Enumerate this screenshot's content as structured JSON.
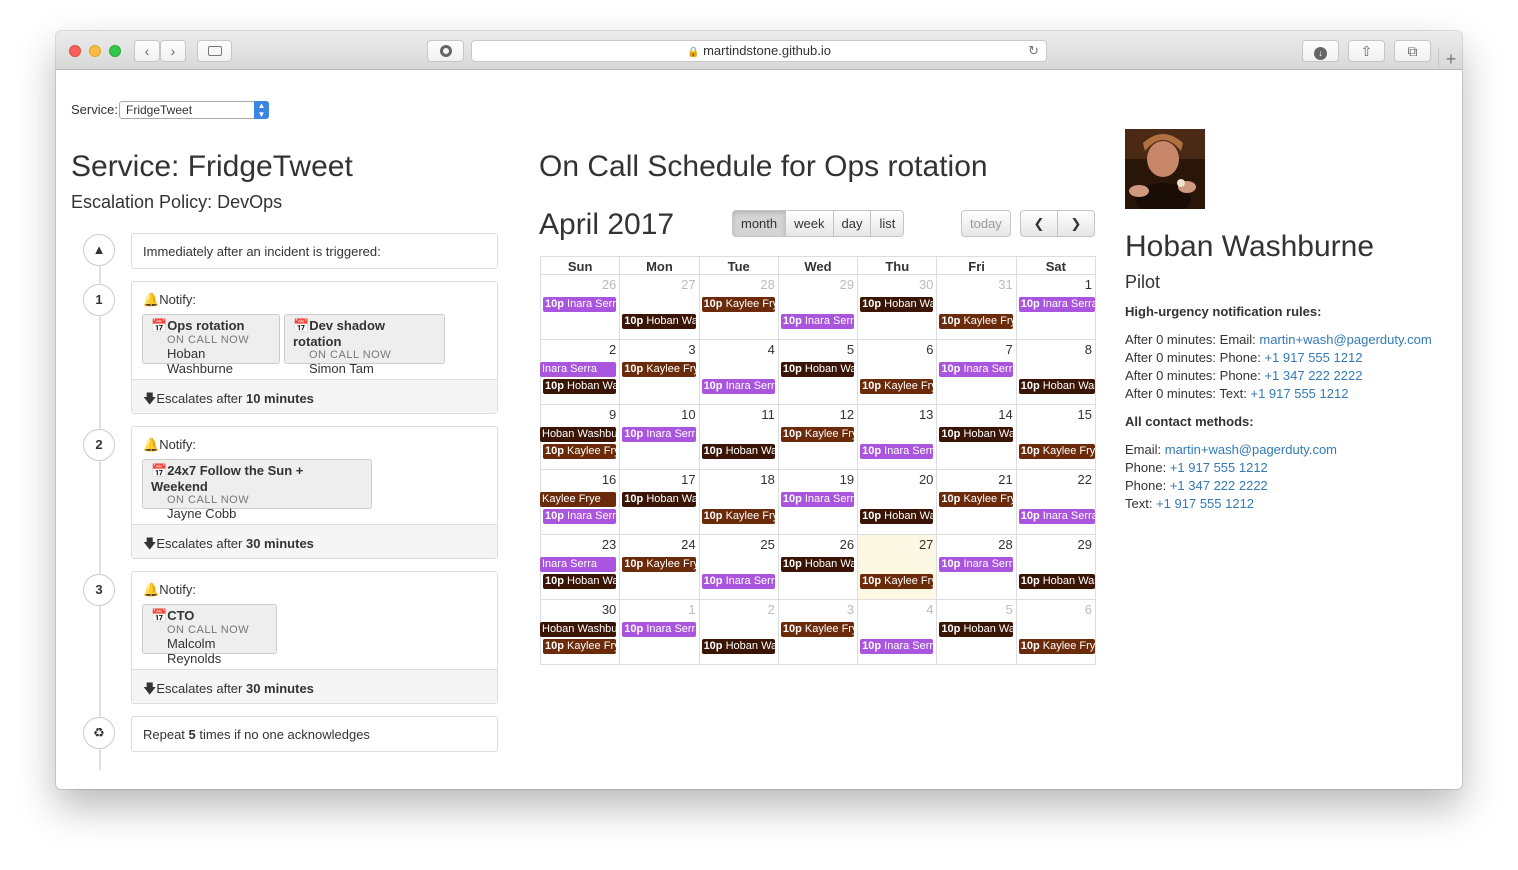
{
  "browser": {
    "url": "martindstone.github.io"
  },
  "service_select": {
    "label": "Service:",
    "value": "FridgeTweet"
  },
  "service": {
    "title": "Service: FridgeTweet",
    "escalation_policy": "Escalation Policy: DevOps",
    "trigger_text": "Immediately after an incident is triggered:",
    "rules": [
      {
        "number": "1",
        "notify_label": "Notify:",
        "targets": [
          {
            "name": "Ops rotation",
            "status": "ON CALL NOW",
            "person": "Hoban Washburne"
          },
          {
            "name": "Dev shadow rotation",
            "status": "ON CALL NOW",
            "person": "Simon Tam"
          }
        ],
        "escalate_prefix": "Escalates after ",
        "escalate_value": "10 minutes"
      },
      {
        "number": "2",
        "notify_label": "Notify:",
        "targets": [
          {
            "name": "24x7 Follow the Sun + Weekend",
            "status": "ON CALL NOW",
            "person": "Jayne Cobb"
          }
        ],
        "escalate_prefix": "Escalates after ",
        "escalate_value": "30 minutes"
      },
      {
        "number": "3",
        "notify_label": "Notify:",
        "targets": [
          {
            "name": "CTO",
            "status": "ON CALL NOW",
            "person": "Malcolm Reynolds"
          }
        ],
        "escalate_prefix": "Escalates after ",
        "escalate_value": "30 minutes"
      }
    ],
    "repeat_prefix": "Repeat ",
    "repeat_count": "5",
    "repeat_suffix": " times if no one acknowledges"
  },
  "calendar": {
    "title": "On Call Schedule for Ops rotation",
    "month": "April 2017",
    "view_buttons": [
      "month",
      "week",
      "day",
      "list"
    ],
    "active_view": "month",
    "today_label": "today",
    "prev_icon": "chevron-left-icon",
    "next_icon": "chevron-right-icon",
    "dow": [
      "Sun",
      "Mon",
      "Tue",
      "Wed",
      "Thu",
      "Fri",
      "Sat"
    ],
    "weeks": [
      [
        "26",
        "27",
        "28",
        "29",
        "30",
        "31",
        "1"
      ],
      [
        "2",
        "3",
        "4",
        "5",
        "6",
        "7",
        "8"
      ],
      [
        "9",
        "10",
        "11",
        "12",
        "13",
        "14",
        "15"
      ],
      [
        "16",
        "17",
        "18",
        "19",
        "20",
        "21",
        "22"
      ],
      [
        "23",
        "24",
        "25",
        "26",
        "27",
        "28",
        "29"
      ],
      [
        "30",
        "1",
        "2",
        "3",
        "4",
        "5",
        "6"
      ]
    ],
    "today": "27",
    "people_colors": {
      "Inara Serra": "#aa55dd",
      "Kaylee Frye": "#6b2a0a",
      "Hoban Washburne": "#3a1505"
    },
    "events": [
      {
        "week": 0,
        "row": 0,
        "start": 0,
        "end": 1,
        "time": "10p",
        "name": "Inara Serra"
      },
      {
        "week": 0,
        "row": 0,
        "start": 2,
        "end": 3,
        "time": "10p",
        "name": "Kaylee Frye"
      },
      {
        "week": 0,
        "row": 0,
        "start": 4,
        "end": 5,
        "time": "10p",
        "name": "Hoban Washburne"
      },
      {
        "week": 0,
        "row": 0,
        "start": 6,
        "end": 7,
        "time": "10p",
        "name": "Inara Serra"
      },
      {
        "week": 0,
        "row": 1,
        "start": 1,
        "end": 2,
        "time": "10p",
        "name": "Hoban Washburne"
      },
      {
        "week": 0,
        "row": 1,
        "start": 3,
        "end": 4,
        "time": "10p",
        "name": "Inara Serra"
      },
      {
        "week": 0,
        "row": 1,
        "start": 5,
        "end": 6,
        "time": "10p",
        "name": "Kaylee Frye"
      },
      {
        "week": 1,
        "row": 0,
        "start": 0,
        "end": 1,
        "time": "",
        "name": "Inara Serra"
      },
      {
        "week": 1,
        "row": 0,
        "start": 1,
        "end": 2,
        "time": "10p",
        "name": "Kaylee Frye"
      },
      {
        "week": 1,
        "row": 0,
        "start": 3,
        "end": 4,
        "time": "10p",
        "name": "Hoban Washburne"
      },
      {
        "week": 1,
        "row": 0,
        "start": 5,
        "end": 6,
        "time": "10p",
        "name": "Inara Serra"
      },
      {
        "week": 1,
        "row": 1,
        "start": 0,
        "end": 1,
        "time": "10p",
        "name": "Hoban Washburne"
      },
      {
        "week": 1,
        "row": 1,
        "start": 2,
        "end": 3,
        "time": "10p",
        "name": "Inara Serra"
      },
      {
        "week": 1,
        "row": 1,
        "start": 4,
        "end": 5,
        "time": "10p",
        "name": "Kaylee Frye"
      },
      {
        "week": 1,
        "row": 1,
        "start": 6,
        "end": 7,
        "time": "10p",
        "name": "Hoban Washburne"
      },
      {
        "week": 2,
        "row": 0,
        "start": 0,
        "end": 1,
        "time": "",
        "name": "Hoban Washburne"
      },
      {
        "week": 2,
        "row": 0,
        "start": 1,
        "end": 2,
        "time": "10p",
        "name": "Inara Serra"
      },
      {
        "week": 2,
        "row": 0,
        "start": 3,
        "end": 4,
        "time": "10p",
        "name": "Kaylee Frye"
      },
      {
        "week": 2,
        "row": 0,
        "start": 5,
        "end": 6,
        "time": "10p",
        "name": "Hoban Washburne"
      },
      {
        "week": 2,
        "row": 1,
        "start": 0,
        "end": 1,
        "time": "10p",
        "name": "Kaylee Frye"
      },
      {
        "week": 2,
        "row": 1,
        "start": 2,
        "end": 3,
        "time": "10p",
        "name": "Hoban Washburne"
      },
      {
        "week": 2,
        "row": 1,
        "start": 4,
        "end": 5,
        "time": "10p",
        "name": "Inara Serra"
      },
      {
        "week": 2,
        "row": 1,
        "start": 6,
        "end": 7,
        "time": "10p",
        "name": "Kaylee Frye"
      },
      {
        "week": 3,
        "row": 0,
        "start": 0,
        "end": 1,
        "time": "",
        "name": "Kaylee Frye"
      },
      {
        "week": 3,
        "row": 0,
        "start": 1,
        "end": 2,
        "time": "10p",
        "name": "Hoban Washburne"
      },
      {
        "week": 3,
        "row": 0,
        "start": 3,
        "end": 4,
        "time": "10p",
        "name": "Inara Serra"
      },
      {
        "week": 3,
        "row": 0,
        "start": 5,
        "end": 6,
        "time": "10p",
        "name": "Kaylee Frye"
      },
      {
        "week": 3,
        "row": 1,
        "start": 0,
        "end": 1,
        "time": "10p",
        "name": "Inara Serra"
      },
      {
        "week": 3,
        "row": 1,
        "start": 2,
        "end": 3,
        "time": "10p",
        "name": "Kaylee Frye"
      },
      {
        "week": 3,
        "row": 1,
        "start": 4,
        "end": 5,
        "time": "10p",
        "name": "Hoban Washburne"
      },
      {
        "week": 3,
        "row": 1,
        "start": 6,
        "end": 7,
        "time": "10p",
        "name": "Inara Serra"
      },
      {
        "week": 4,
        "row": 0,
        "start": 0,
        "end": 1,
        "time": "",
        "name": "Inara Serra"
      },
      {
        "week": 4,
        "row": 0,
        "start": 1,
        "end": 2,
        "time": "10p",
        "name": "Kaylee Frye"
      },
      {
        "week": 4,
        "row": 0,
        "start": 3,
        "end": 4,
        "time": "10p",
        "name": "Hoban Washburne"
      },
      {
        "week": 4,
        "row": 0,
        "start": 5,
        "end": 6,
        "time": "10p",
        "name": "Inara Serra"
      },
      {
        "week": 4,
        "row": 1,
        "start": 0,
        "end": 1,
        "time": "10p",
        "name": "Hoban Washburne"
      },
      {
        "week": 4,
        "row": 1,
        "start": 2,
        "end": 3,
        "time": "10p",
        "name": "Inara Serra"
      },
      {
        "week": 4,
        "row": 1,
        "start": 4,
        "end": 5,
        "time": "10p",
        "name": "Kaylee Frye"
      },
      {
        "week": 4,
        "row": 1,
        "start": 6,
        "end": 7,
        "time": "10p",
        "name": "Hoban Washburne"
      },
      {
        "week": 5,
        "row": 0,
        "start": 0,
        "end": 1,
        "time": "",
        "name": "Hoban Washburne"
      },
      {
        "week": 5,
        "row": 0,
        "start": 1,
        "end": 2,
        "time": "10p",
        "name": "Inara Serra"
      },
      {
        "week": 5,
        "row": 0,
        "start": 3,
        "end": 4,
        "time": "10p",
        "name": "Kaylee Frye"
      },
      {
        "week": 5,
        "row": 0,
        "start": 5,
        "end": 6,
        "time": "10p",
        "name": "Hoban Washburne"
      },
      {
        "week": 5,
        "row": 1,
        "start": 0,
        "end": 1,
        "time": "10p",
        "name": "Kaylee Frye"
      },
      {
        "week": 5,
        "row": 1,
        "start": 2,
        "end": 3,
        "time": "10p",
        "name": "Hoban Washburne"
      },
      {
        "week": 5,
        "row": 1,
        "start": 4,
        "end": 5,
        "time": "10p",
        "name": "Inara Serra"
      },
      {
        "week": 5,
        "row": 1,
        "start": 6,
        "end": 7,
        "time": "10p",
        "name": "Kaylee Frye"
      }
    ]
  },
  "profile": {
    "name": "Hoban Washburne",
    "role": "Pilot",
    "rules_heading": "High-urgency notification rules:",
    "rules": [
      {
        "prefix": "After 0 minutes: Email: ",
        "value": "martin+wash@pagerduty.com"
      },
      {
        "prefix": "After 0 minutes: Phone: ",
        "value": "+1 917 555 1212"
      },
      {
        "prefix": "After 0 minutes: Phone: ",
        "value": "+1 347 222 2222"
      },
      {
        "prefix": "After 0 minutes: Text: ",
        "value": "+1 917 555 1212"
      }
    ],
    "contacts_heading": "All contact methods:",
    "contacts": [
      {
        "prefix": "Email: ",
        "value": "martin+wash@pagerduty.com"
      },
      {
        "prefix": "Phone: ",
        "value": "+1 917 555 1212"
      },
      {
        "prefix": "Phone: ",
        "value": "+1 347 222 2222"
      },
      {
        "prefix": "Text: ",
        "value": "+1 917 555 1212"
      }
    ]
  }
}
